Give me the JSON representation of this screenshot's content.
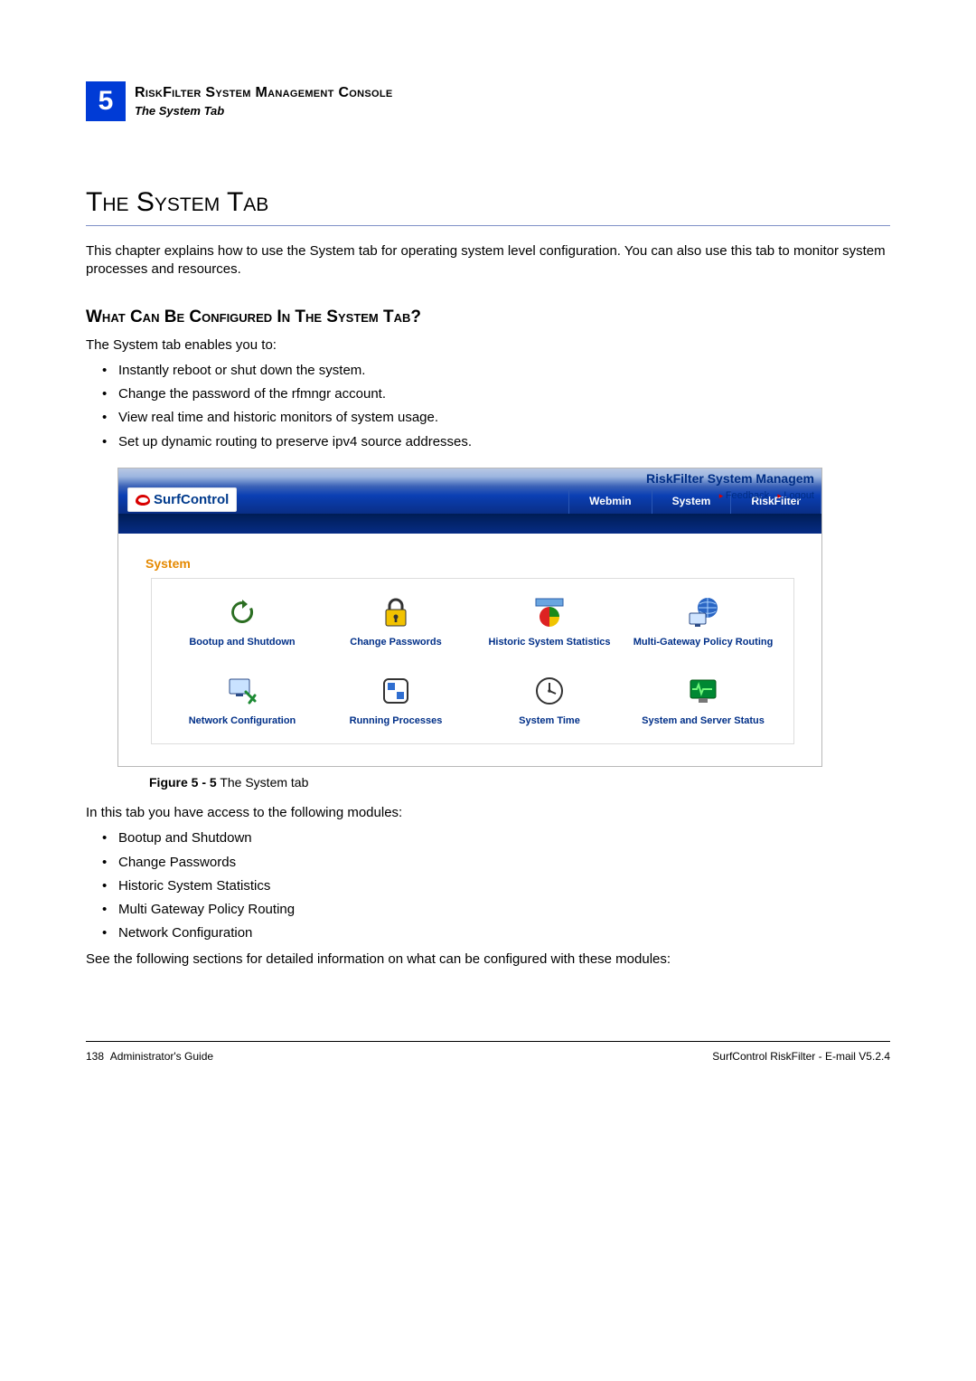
{
  "chapter": {
    "number": "5",
    "title": "RiskFilter System Management Console",
    "subtitle": "The System Tab"
  },
  "section_title": "The System Tab",
  "intro_para": "This chapter explains how to use the System tab for operating system level configuration. You can also use this tab to monitor system processes and resources.",
  "subsection_title": "What Can Be Configured In The System Tab?",
  "enables_lead": "The System tab enables you to:",
  "enables_list": [
    "Instantly reboot or shut down the system.",
    "Change the password of the rfmngr account.",
    "View real time and historic monitors of system usage.",
    "Set up dynamic routing to preserve ipv4 source addresses."
  ],
  "screenshot": {
    "logo_text": "SurfControl",
    "tabs": [
      "Webmin",
      "System",
      "RiskFilter"
    ],
    "app_title": "RiskFilter System Managem",
    "feedback": "Feedback..",
    "logout": "Logout",
    "panel_heading": "System",
    "modules": [
      "Bootup and Shutdown",
      "Change Passwords",
      "Historic System Statistics",
      "Multi-Gateway Policy Routing",
      "Network Configuration",
      "Running Processes",
      "System Time",
      "System and Server Status"
    ]
  },
  "figure_caption_label": "Figure 5 - 5",
  "figure_caption_text": " The System tab",
  "access_lead": "In this tab you have access to the following modules:",
  "access_list": [
    "Bootup and Shutdown",
    "Change Passwords",
    "Historic System Statistics",
    "Multi Gateway Policy Routing",
    "Network Configuration"
  ],
  "see_text": "See the following sections for detailed information on what can be configured with these modules:",
  "footer": {
    "left_page": "138",
    "left_text": "Administrator's Guide",
    "right_text": "SurfControl RiskFilter - E-mail V5.2.4"
  }
}
